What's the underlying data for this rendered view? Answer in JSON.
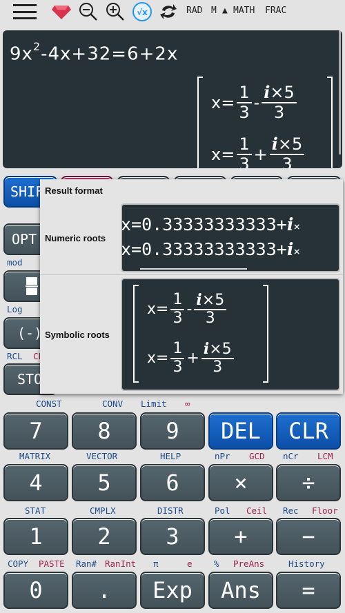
{
  "toolbar": {
    "icons": [
      "menu-icon",
      "gem-icon",
      "zoom-out-icon",
      "zoom-in-icon",
      "sqrt-x-icon",
      "refresh-icon"
    ],
    "status": {
      "angle": "RAD",
      "memory": "M",
      "indicator": "▲",
      "input_mode": "MATH",
      "output_mode": "FRAC"
    },
    "accent": "#2196f3"
  },
  "display": {
    "expression": {
      "base": "9x",
      "exp": "2",
      "rest": "-4x+32=6+2x"
    },
    "roots": [
      {
        "lhs": "x=",
        "a_num": "1",
        "a_den": "3",
        "op": "-",
        "b_num_i": "i",
        "b_num_rest": "×5",
        "b_den": "3"
      },
      {
        "lhs": "x=",
        "a_num": "1",
        "a_den": "3",
        "op": "+",
        "b_num_i": "i",
        "b_num_rest": "×5",
        "b_den": "3"
      }
    ]
  },
  "popup": {
    "title": "Result format",
    "numeric": {
      "label": "Numeric roots",
      "lines": [
        {
          "value": "x=0.33333333333+",
          "i": "i",
          "rest": "×"
        },
        {
          "value": "x=0.33333333333+",
          "i": "i",
          "rest": "×"
        }
      ]
    },
    "symbolic": {
      "label": "Symbolic roots"
    }
  },
  "hidden_keys": {
    "shift": "SHIF",
    "opt": "OPT",
    "neg": "(-)",
    "sto": "STO",
    "mod": "mod",
    "log": "Log",
    "rcl": "RCL",
    "cl": "CL"
  },
  "keypad": {
    "row1_labels": [
      "CONST",
      "CONV",
      "Limit",
      "∞"
    ],
    "row1": [
      "7",
      "8",
      "9",
      "DEL",
      "CLR"
    ],
    "row2_labels": [
      "MATRIX",
      "VECTOR",
      "HELP",
      "nPr",
      "GCD",
      "nCr",
      "LCM"
    ],
    "row2": [
      "4",
      "5",
      "6",
      "×",
      "÷"
    ],
    "row3_labels": [
      "STAT",
      "CMPLX",
      "DISTR",
      "Pol",
      "Ceil",
      "Rec",
      "Floor"
    ],
    "row3": [
      "1",
      "2",
      "3",
      "+",
      "−"
    ],
    "row4_labels": [
      "COPY",
      "PASTE",
      "Ran#",
      "RanInt",
      "π",
      "e",
      "%",
      "PreAns",
      "History"
    ],
    "row4": [
      "0",
      ".",
      "Exp",
      "Ans",
      "="
    ]
  },
  "colors": {
    "shift_blue": "#0c4fa8",
    "alpha_pink": "#a0204e",
    "key_gray": "#4b5a61",
    "display_bg": "#263238"
  }
}
